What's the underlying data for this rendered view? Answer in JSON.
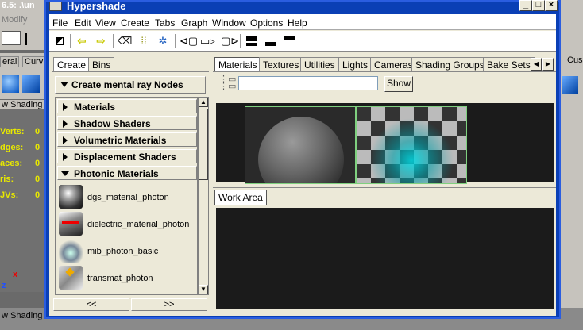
{
  "background_app": {
    "title_fragment": "6.5: .\\un",
    "menu_fragment": "Modify",
    "shelf_tabs": [
      "eral",
      "Curv"
    ],
    "right_shelf_tab": "Cus",
    "viewport_label": "w  Shading",
    "bottom_label": "w  Shading",
    "hud": [
      {
        "label": "Verts:",
        "value": "0"
      },
      {
        "label": "dges:",
        "value": "0"
      },
      {
        "label": "aces:",
        "value": "0"
      },
      {
        "label": "ris:",
        "value": "0"
      },
      {
        "label": "JVs:",
        "value": "0"
      }
    ],
    "axis_x": "x",
    "axis_z": "z"
  },
  "window": {
    "title": "Hypershade",
    "min_glyph": "_",
    "max_glyph": "□",
    "close_glyph": "×"
  },
  "menubar": [
    "File",
    "Edit",
    "View",
    "Create",
    "Tabs",
    "Graph",
    "Window",
    "Options",
    "Help"
  ],
  "toolbar": {
    "icons": [
      "graph-nodes-icon",
      "back-arrow-icon",
      "forward-arrow-icon",
      "clear-graph-icon",
      "rearrange-icon",
      "graph-materials-icon",
      "input-connections-icon",
      "input-output-icon",
      "output-connections-icon",
      "top-tab-only-icon",
      "bottom-tab-only-icon",
      "top-bottom-tabs-icon"
    ]
  },
  "left_panel": {
    "tabs": [
      "Create",
      "Bins"
    ],
    "create_button": "Create mental ray Nodes",
    "categories": [
      "Materials",
      "Shadow Shaders",
      "Volumetric Materials",
      "Displacement Shaders",
      "Photonic Materials"
    ],
    "nodes": [
      "dgs_material_photon",
      "dielectric_material_photon",
      "mib_photon_basic",
      "transmat_photon"
    ],
    "nav_prev": "<<",
    "nav_next": ">>"
  },
  "right_panel": {
    "tabs": [
      "Materials",
      "Textures",
      "Utilities",
      "Lights",
      "Cameras",
      "Shading Groups",
      "Bake Sets"
    ],
    "active_tab": "Materials",
    "search_value": "",
    "show_button": "Show",
    "work_area_tab": "Work Area"
  },
  "colors": {
    "window_border": "#0a3fb5",
    "panel_bg": "#ece9d8",
    "swatch_bg": "#1b1b1b",
    "selection_outline": "#7fd07f"
  }
}
